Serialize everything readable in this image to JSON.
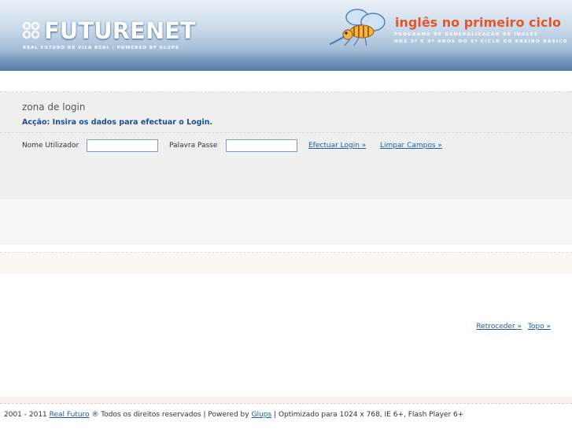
{
  "header": {
    "logo": "FUTURENET",
    "tagline_a": "Real Futuro de Vila Real",
    "tagline_sep": "|",
    "tagline_b": "Powered by Glups",
    "program_title": "inglês no primeiro ciclo",
    "program_sub1": "programa de generalização de inglês",
    "program_sub2": "nos 3º e 4º anos do 1º ciclo do ensino básico",
    "colors": {
      "title": "#e2562b",
      "header_top": "#e9f0f7",
      "header_bottom": "#6f93bb"
    }
  },
  "login": {
    "title": "zona de login",
    "action_label": "Acção:",
    "action_text": "Insira os dados para efectuar o Login.",
    "username_label": "Nome Utilizador",
    "username_value": "",
    "password_label": "Palavra Passe",
    "password_value": "",
    "submit_link": "Efectuar Login »",
    "clear_link": "Limpar Campos »"
  },
  "nav": {
    "back": "Retroceder »",
    "top": "Topo »"
  },
  "footer": {
    "years": "2001 - 2011",
    "company": "Real Futuro",
    "rights": "® Todos os direitos reservados |",
    "powered": "Powered by",
    "powered_link": "Glups",
    "optimized": "| Optimizado para 1024 x 768, IE 6+, Flash Player 6+"
  }
}
